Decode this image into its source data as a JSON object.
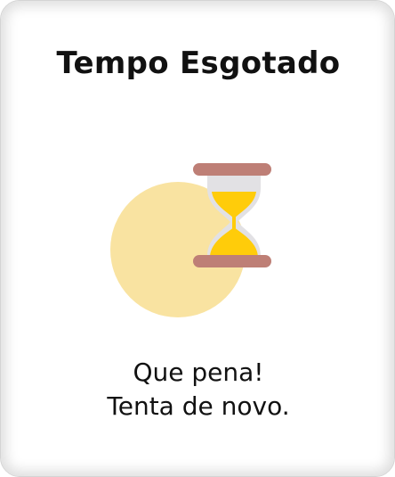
{
  "dialog": {
    "title": "Tempo Esgotado",
    "message_line1": "Que pena!",
    "message_line2": "Tenta de novo."
  },
  "illustration": {
    "icon": "hourglass-icon",
    "circle_color": "#F9E3A1",
    "sand_color": "#FFCC0A",
    "cap_color": "#BE7F76",
    "glass_color": "#E2E1E4"
  }
}
